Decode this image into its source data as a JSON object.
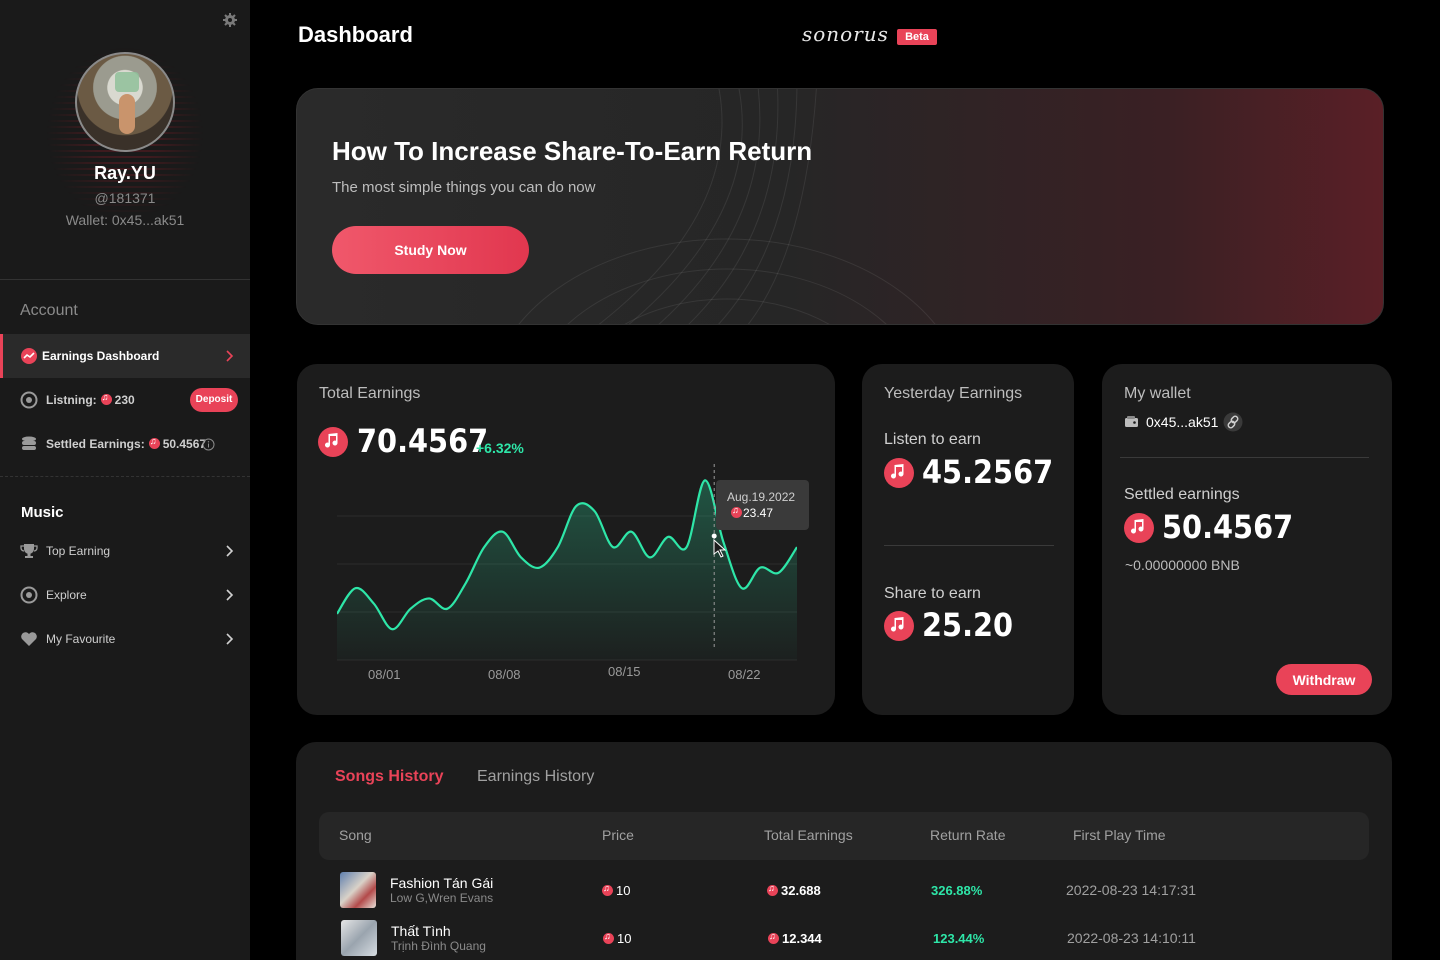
{
  "app": {
    "brand": "sonorus",
    "beta_label": "Beta",
    "page_title": "Dashboard"
  },
  "colors": {
    "accent": "#e94358",
    "positive": "#2ee6a8",
    "background": "#000000",
    "card": "#1c1c1c"
  },
  "profile": {
    "name": "Ray.YU",
    "handle": "@181371",
    "wallet": "Wallet: 0x45...ak51"
  },
  "sidebar": {
    "account_heading": "Account",
    "items": [
      {
        "label": "Earnings Dashboard",
        "icon": "dashboard-icon",
        "active": true
      },
      {
        "label": "Listning:",
        "value": "230",
        "icon": "disc-icon",
        "action": "Deposit"
      },
      {
        "label": "Settled Earnings:",
        "value": "50.4567",
        "icon": "database-icon",
        "info_icon": "info-icon"
      }
    ],
    "music_heading": "Music",
    "music_items": [
      {
        "label": "Top Earning",
        "icon": "trophy-icon"
      },
      {
        "label": "Explore",
        "icon": "explore-icon"
      },
      {
        "label": "My Favourite",
        "icon": "heart-icon"
      }
    ]
  },
  "banner": {
    "title": "How To Increase Share-To-Earn Return",
    "subtitle": "The most simple things you can do now",
    "button": "Study Now"
  },
  "total_earnings": {
    "label": "Total Earnings",
    "value": "70.4567",
    "change": "+6.32%",
    "tooltip": {
      "date": "Aug.19.2022",
      "value": "23.47"
    }
  },
  "chart_data": {
    "type": "area",
    "title": "",
    "x_ticks": [
      "08/01",
      "08/08",
      "08/15",
      "08/22"
    ],
    "x": [
      "07/30",
      "07/31",
      "08/01",
      "08/02",
      "08/03",
      "08/04",
      "08/05",
      "08/06",
      "08/07",
      "08/08",
      "08/09",
      "08/10",
      "08/11",
      "08/12",
      "08/13",
      "08/14",
      "08/15",
      "08/16",
      "08/17",
      "08/18",
      "08/19",
      "08/20",
      "08/21",
      "08/22",
      "08/23",
      "08/24"
    ],
    "values": [
      9,
      14,
      11,
      6,
      10,
      12,
      10,
      15,
      22,
      25,
      20,
      18,
      22,
      30,
      29,
      22,
      25,
      20,
      24,
      22,
      35,
      23,
      14,
      18,
      17,
      22
    ],
    "highlight": {
      "x": "08/19",
      "value": 23.47
    },
    "grid": true,
    "legend": "none"
  },
  "yesterday": {
    "label": "Yesterday Earnings",
    "listen_label": "Listen to earn",
    "listen_value": "45.2567",
    "share_label": "Share to earn",
    "share_value": "25.20"
  },
  "wallet": {
    "label": "My wallet",
    "address": "0x45...ak51",
    "settled_label": "Settled earnings",
    "settled_value": "50.4567",
    "bnb": "~0.00000000 BNB",
    "button": "Withdraw"
  },
  "history": {
    "tabs": [
      "Songs History",
      "Earnings History"
    ],
    "columns": [
      "Song",
      "Price",
      "Total Earnings",
      "Return Rate",
      "First Play Time"
    ],
    "rows": [
      {
        "title": "Fashion Tán Gái",
        "artist": "Low G,Wren Evans",
        "price": "10",
        "total": "32.688",
        "rate": "326.88%",
        "time": "2022-08-23 14:17:31"
      },
      {
        "title": "Thất Tình",
        "artist": "Trịnh Đình Quang",
        "price": "10",
        "total": "12.344",
        "rate": "123.44%",
        "time": "2022-08-23 14:10:11"
      }
    ]
  }
}
